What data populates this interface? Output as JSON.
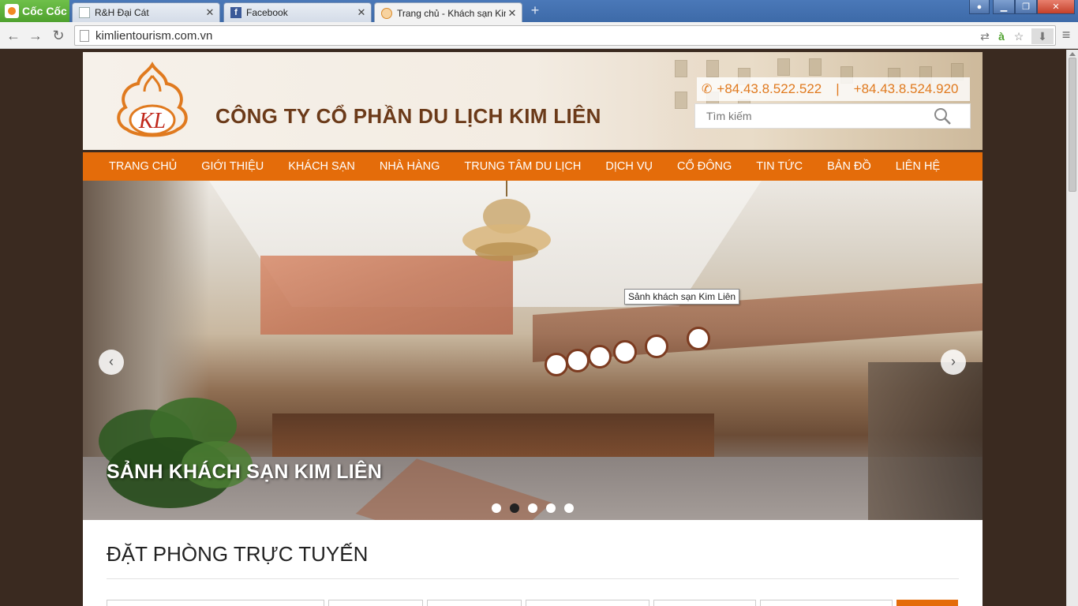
{
  "browser": {
    "brand": "Cốc Cốc",
    "tabs": [
      {
        "label": "R&H Đại Cát",
        "active": false
      },
      {
        "label": "Facebook",
        "active": false
      },
      {
        "label": "Trang chủ - Khách sạn Kim",
        "active": true
      }
    ],
    "url": "kimlientourism.com.vn"
  },
  "header": {
    "logo_text": "KL",
    "company_name": "CÔNG TY CỔ PHẦN DU LỊCH KIM LIÊN",
    "phone_1": "+84.43.8.522.522",
    "phone_sep": "|",
    "phone_2": "+84.43.8.524.920",
    "search_placeholder": "Tìm kiếm"
  },
  "nav": {
    "items": [
      "TRANG CHỦ",
      "GIỚI THIỆU",
      "KHÁCH SẠN",
      "NHÀ HÀNG",
      "TRUNG TÂM DU LỊCH",
      "DỊCH VỤ",
      "CỔ ĐÔNG",
      "TIN TỨC",
      "BẢN ĐỒ",
      "LIÊN HỆ"
    ]
  },
  "slider": {
    "caption": "SẢNH KHÁCH SẠN KIM LIÊN",
    "tooltip": "Sảnh khách sạn Kim Liên",
    "slide_count": 5,
    "active_slide": 2
  },
  "booking": {
    "title": "ĐẶT PHÒNG TRỰC TUYẾN"
  },
  "colors": {
    "accent_orange": "#e46c0a",
    "brand_brown": "#6b3a19",
    "page_background": "#3a2a20"
  }
}
